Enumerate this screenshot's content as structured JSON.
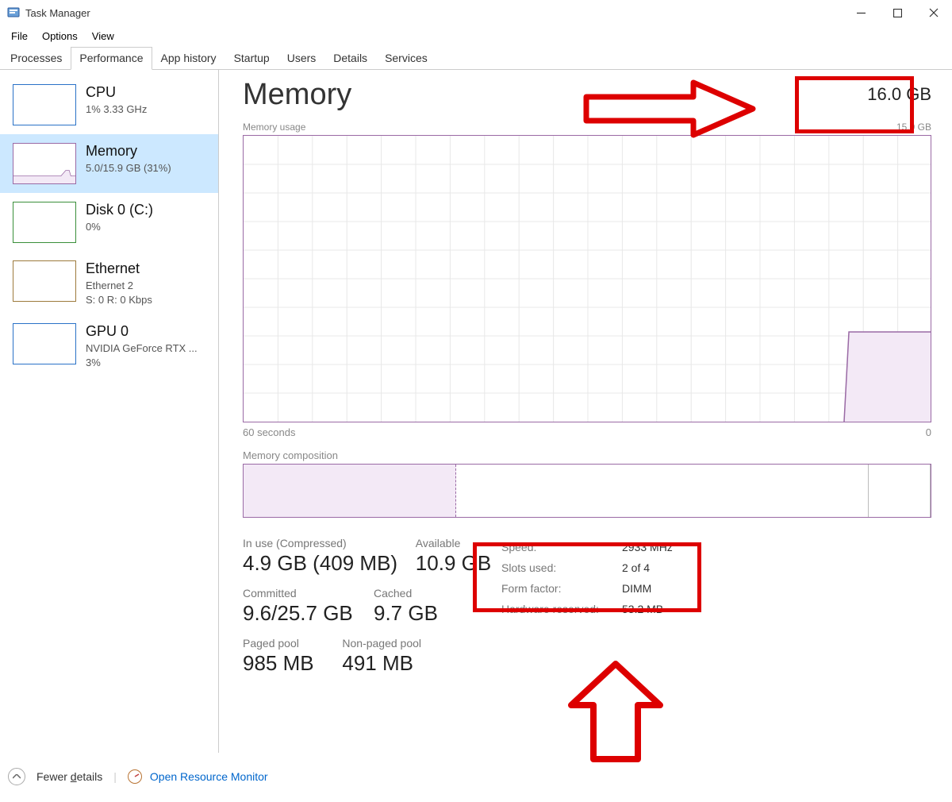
{
  "window_title": "Task Manager",
  "menus": [
    "File",
    "Options",
    "View"
  ],
  "tabs": [
    "Processes",
    "Performance",
    "App history",
    "Startup",
    "Users",
    "Details",
    "Services"
  ],
  "active_tab": "Performance",
  "sidebar": {
    "items": [
      {
        "title": "CPU",
        "sub": "1%  3.33 GHz",
        "border": "#2a72c7"
      },
      {
        "title": "Memory",
        "sub": "5.0/15.9 GB (31%)",
        "border": "#9a6aa5",
        "selected": true
      },
      {
        "title": "Disk 0 (C:)",
        "sub": "0%",
        "border": "#3a8f3a"
      },
      {
        "title": "Ethernet",
        "sub": "Ethernet 2",
        "sub2": "S: 0  R: 0 Kbps",
        "border": "#9d7a3c"
      },
      {
        "title": "GPU 0",
        "sub": "NVIDIA GeForce RTX ...",
        "sub2": "3%",
        "border": "#2a72c7"
      }
    ]
  },
  "memory": {
    "title": "Memory",
    "total": "16.0 GB",
    "usage_label": "Memory usage",
    "usage_max": "15.9 GB",
    "x_left": "60 seconds",
    "x_right": "0",
    "composition_label": "Memory composition",
    "stats": {
      "inuse_label": "In use (Compressed)",
      "inuse_value": "4.9 GB (409 MB)",
      "available_label": "Available",
      "available_value": "10.9 GB",
      "committed_label": "Committed",
      "committed_value": "9.6/25.7 GB",
      "cached_label": "Cached",
      "cached_value": "9.7 GB",
      "paged_label": "Paged pool",
      "paged_value": "985 MB",
      "nonpaged_label": "Non-paged pool",
      "nonpaged_value": "491 MB"
    },
    "details": {
      "speed_label": "Speed:",
      "speed": "2933 MHz",
      "slots_label": "Slots used:",
      "slots": "2 of 4",
      "form_label": "Form factor:",
      "form": "DIMM",
      "hw_label": "Hardware reserved:",
      "hw": "53.2 MB"
    }
  },
  "status": {
    "fewer": "Fewer details",
    "resource": "Open Resource Monitor"
  },
  "chart_data": {
    "type": "area",
    "title": "Memory usage",
    "ylabel": "GB",
    "ylim": [
      0,
      15.9
    ],
    "x_range_seconds": [
      60,
      0
    ],
    "series": [
      {
        "name": "In use",
        "approx_values_gb": [
          5.0,
          5.0,
          5.0,
          5.0
        ],
        "note": "roughly flat ~5 GB with tiny spike near right edge"
      }
    ]
  }
}
